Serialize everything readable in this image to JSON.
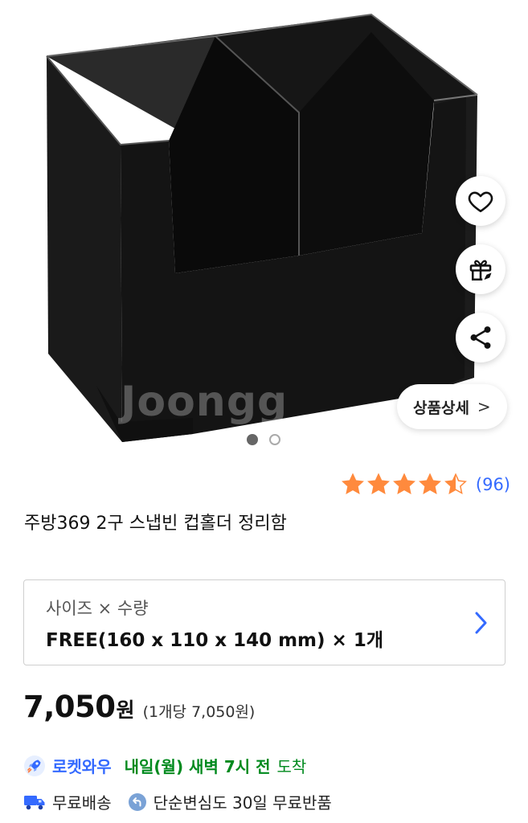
{
  "hero": {
    "watermark": "Joongg",
    "detail_button_label": "상품상세",
    "detail_button_chevron": ">",
    "carousel": {
      "total": 2,
      "active_index": 0
    },
    "icons": [
      "heart-icon",
      "gift-rocket-icon",
      "share-icon"
    ]
  },
  "rating": {
    "stars": 4.5,
    "max": 5,
    "count_label": "(96)",
    "star_color": "#ff8a3d"
  },
  "product": {
    "title": "주방369 2구 스냅빈 컵홀더 정리함"
  },
  "option": {
    "label": "사이즈 × 수량",
    "value": "FREE(160 x 110 x 140 mm) × 1개"
  },
  "price": {
    "amount": "7,050",
    "unit": "원",
    "per_unit": "(1개당 7,050원)"
  },
  "delivery": {
    "brand": "로켓와우",
    "eta": "내일(월) 새벽 7시 전",
    "arrive": "도착",
    "brand_color": "#346aff",
    "eta_color": "#008a1e"
  },
  "shipping": {
    "free_shipping": "무료배송",
    "free_return": "단순변심도 30일 무료반품"
  }
}
